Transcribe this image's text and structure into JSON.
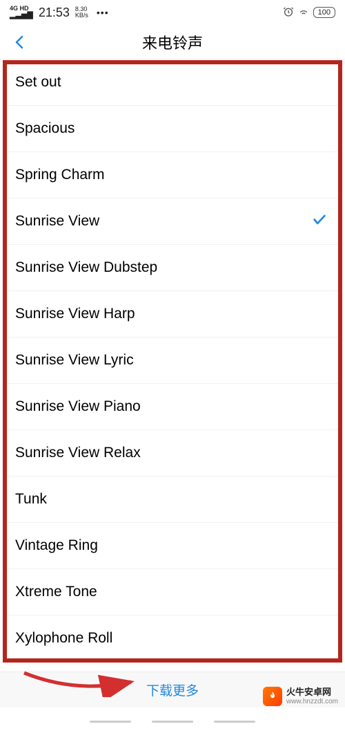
{
  "statusBar": {
    "networkType": "4G HD",
    "time": "21:53",
    "netSpeed": "8.30",
    "netUnit": "KB/s",
    "dots": "•••",
    "battery": "100"
  },
  "header": {
    "title": "来电铃声"
  },
  "ringtones": [
    {
      "label": "Set out",
      "selected": false
    },
    {
      "label": "Spacious",
      "selected": false
    },
    {
      "label": "Spring Charm",
      "selected": false
    },
    {
      "label": "Sunrise View",
      "selected": true
    },
    {
      "label": "Sunrise View Dubstep",
      "selected": false
    },
    {
      "label": "Sunrise View Harp",
      "selected": false
    },
    {
      "label": "Sunrise View Lyric",
      "selected": false
    },
    {
      "label": "Sunrise View Piano",
      "selected": false
    },
    {
      "label": "Sunrise View Relax",
      "selected": false
    },
    {
      "label": "Tunk",
      "selected": false
    },
    {
      "label": "Vintage Ring",
      "selected": false
    },
    {
      "label": "Xtreme Tone",
      "selected": false
    },
    {
      "label": "Xylophone Roll",
      "selected": false
    }
  ],
  "bottomBar": {
    "downloadMore": "下载更多"
  },
  "watermark": {
    "line1": "火牛安卓网",
    "line2": "www.hnzzdt.com"
  }
}
